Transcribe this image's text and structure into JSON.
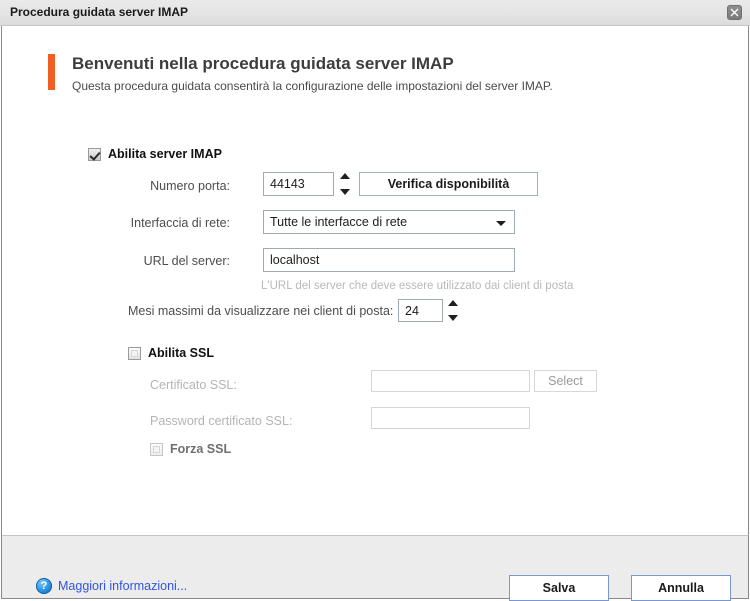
{
  "window": {
    "title": "Procedura guidata server IMAP",
    "close_label": "×"
  },
  "heading": {
    "title": "Benvenuti nella procedura guidata server IMAP",
    "subtitle": "Questa procedura guidata consentirà la configurazione delle impostazioni del server IMAP.",
    "accent_color": "#ef5f22"
  },
  "form": {
    "enable_imap": {
      "label": "Abilita server IMAP",
      "checked": true
    },
    "port": {
      "label": "Numero porta:",
      "value": "44143"
    },
    "check_availability_button": "Verifica disponibilità",
    "interface": {
      "label": "Interfaccia di rete:",
      "value": "Tutte le interfacce di rete",
      "options": [
        "Tutte le interfacce di rete"
      ]
    },
    "server_url": {
      "label": "URL del server:",
      "value": "localhost",
      "hint": "L'URL del server che deve essere utilizzato dai client di posta"
    },
    "max_months": {
      "label": "Mesi massimi da visualizzare nei client di posta:",
      "value": "24"
    }
  },
  "ssl": {
    "enable_ssl": {
      "label": "Abilita SSL",
      "checked": false
    },
    "certificate": {
      "label": "Certificato SSL:",
      "value": "",
      "select_button": "Select"
    },
    "certificate_password": {
      "label": "Password certificato SSL:",
      "value": ""
    },
    "force_ssl": {
      "label": "Forza SSL",
      "checked": false
    }
  },
  "footer": {
    "help_icon_glyph": "?",
    "help_link": "Maggiori informazioni...",
    "save_button": "Salva",
    "cancel_button": "Annulla"
  }
}
